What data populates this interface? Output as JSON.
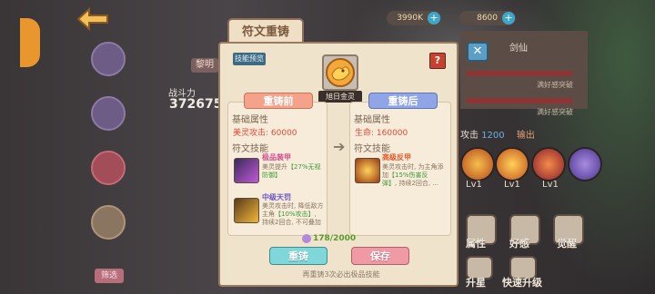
{
  "currency": {
    "gold": "3990K",
    "gems": "8600",
    "plus": "+"
  },
  "left": {
    "name_pill": "黎明",
    "power_label": "战斗力",
    "power_value": "372675",
    "select_button": "筛选"
  },
  "panel": {
    "title": "符文重铸",
    "preview_button": "技能预览",
    "help_button": "?",
    "rune_name": "旭日金灵",
    "close_button": "✕",
    "before": {
      "tab": "重铸前",
      "base_attr_title": "基础属性",
      "attr_text": "美灵攻击: 60000",
      "skill_title": "符文技能",
      "skills": [
        {
          "name": "极品装甲",
          "desc_a": "美灵提升",
          "desc_b": "【27%无视",
          "desc_c": "防御】",
          "color": "#d24a8f"
        },
        {
          "name": "中级天罚",
          "desc_a": "美灵攻击时, 降低敌方",
          "desc_b": "主角",
          "desc_c": "【10%攻击】",
          "desc_d": "持续2回合, 不可叠加",
          "color": "#6a53c9"
        }
      ]
    },
    "after": {
      "tab": "重铸后",
      "base_attr_title": "基础属性",
      "attr_text": "生命: 160000",
      "skill_title": "符文技能",
      "skills": [
        {
          "name": "高级反甲",
          "desc_a": "美灵攻击时, 为主角添",
          "desc_b": "加",
          "desc_c": "【15%伤害反",
          "desc_d": "弹】",
          "desc_e": ", 持续2回合, ...",
          "color": "#e05a2a"
        }
      ]
    },
    "cost_text": "178/2000",
    "recast_button": "重铸",
    "save_button": "保存",
    "hint_text": "再重铸3次必出极品技能"
  },
  "right": {
    "title": "剑仙",
    "note_1": "满好感突破",
    "note_2": "满好感突破",
    "detail_label": "攻击",
    "detail_value": "1200",
    "detail_extra": "输出",
    "skill_levels": [
      "Lv1",
      "Lv1",
      "Lv1"
    ],
    "bottom_labels": [
      "属性",
      "好感",
      "觉醒",
      "升星",
      "快速升级"
    ]
  }
}
